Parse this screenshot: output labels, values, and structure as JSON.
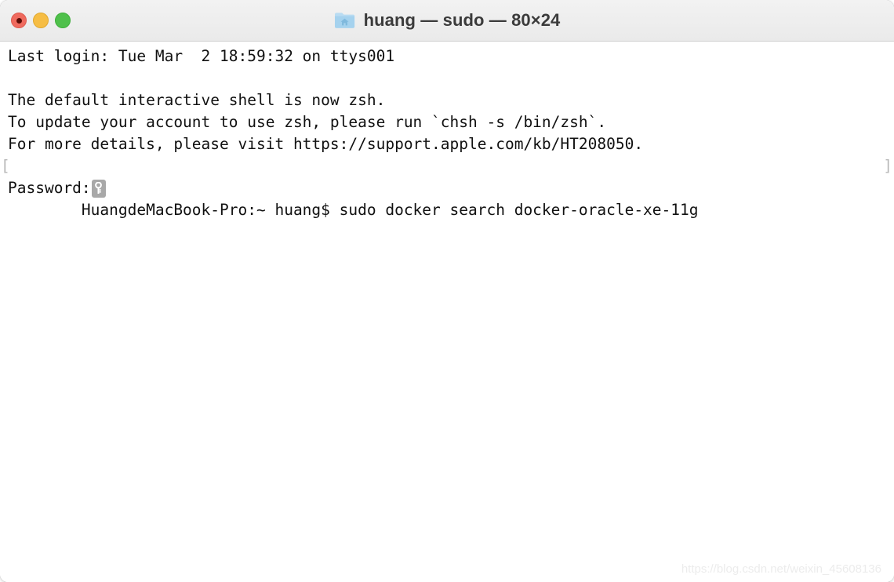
{
  "window": {
    "title_text": "huang — sudo — 80×24",
    "folder_icon_name": "home-folder-icon",
    "titlebar_bg": "#eeeeee",
    "content_bg": "#ffffff",
    "traffic_lights": {
      "close_label": "Close",
      "close_color": "#ef6a5e",
      "minimize_label": "Minimize",
      "minimize_color": "#f6bd44",
      "zoom_label": "Zoom",
      "zoom_color": "#4fc04b"
    }
  },
  "terminal": {
    "columns": 80,
    "rows": 24,
    "text_color": "#111111",
    "prompt_mark_color": "#b9b9b9",
    "prompt_mark_left": "[",
    "prompt_mark_right": "]",
    "lines": [
      {
        "text": "Last login: Tue Mar  2 18:59:32 on ttys001",
        "type": "output"
      },
      {
        "text": "",
        "type": "blank"
      },
      {
        "text": "The default interactive shell is now zsh.",
        "type": "output"
      },
      {
        "text": "To update your account to use zsh, please run `chsh -s /bin/zsh`.",
        "type": "output"
      },
      {
        "text": "For more details, please visit https://support.apple.com/kb/HT208050.",
        "type": "output"
      },
      {
        "text": "HuangdeMacBook-Pro:~ huang$ sudo docker search docker-oracle-xe-11g",
        "type": "prompt"
      }
    ],
    "password_prompt": {
      "label": "Password:",
      "badge_icon_name": "key-icon",
      "badge_color": "#a8a8a8"
    }
  },
  "watermark": {
    "text": "https://blog.csdn.net/weixin_45608136"
  }
}
